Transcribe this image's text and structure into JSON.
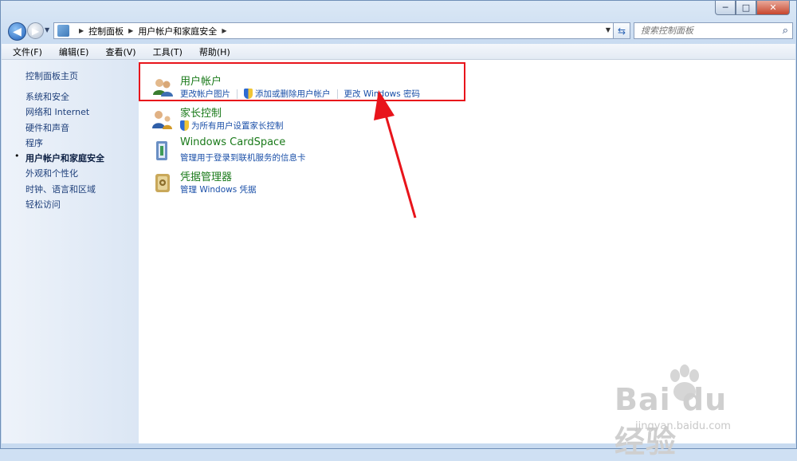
{
  "window": {
    "caption_minimize": "─",
    "caption_maximize": "□",
    "caption_close": "✕"
  },
  "address": {
    "crumbs": [
      "控制面板",
      "用户帐户和家庭安全"
    ],
    "search_placeholder": "搜索控制面板"
  },
  "menu": [
    "文件(F)",
    "编辑(E)",
    "查看(V)",
    "工具(T)",
    "帮助(H)"
  ],
  "sidebar": {
    "home": "控制面板主页",
    "items": [
      {
        "label": "系统和安全",
        "active": false
      },
      {
        "label": "网络和 Internet",
        "active": false
      },
      {
        "label": "硬件和声音",
        "active": false
      },
      {
        "label": "程序",
        "active": false
      },
      {
        "label": "用户帐户和家庭安全",
        "active": true
      },
      {
        "label": "外观和个性化",
        "active": false
      },
      {
        "label": "时钟、语言和区域",
        "active": false
      },
      {
        "label": "轻松访问",
        "active": false
      }
    ]
  },
  "categories": [
    {
      "title": "用户帐户",
      "icon": "user-accounts-icon",
      "links": [
        {
          "label": "更改帐户图片",
          "shield": false
        },
        {
          "label": "添加或删除用户帐户",
          "shield": true
        },
        {
          "label": "更改 Windows 密码",
          "shield": false
        }
      ]
    },
    {
      "title": "家长控制",
      "icon": "parental-controls-icon",
      "links": [
        {
          "label": "为所有用户设置家长控制",
          "shield": true
        }
      ]
    },
    {
      "title": "Windows CardSpace",
      "icon": "cardspace-icon",
      "links": [
        {
          "label": "管理用于登录到联机服务的信息卡",
          "shield": false
        }
      ]
    },
    {
      "title": "凭据管理器",
      "icon": "credential-manager-icon",
      "links": [
        {
          "label": "管理 Windows 凭据",
          "shield": false
        }
      ]
    }
  ],
  "watermark": {
    "logo": "Bai  du 经验",
    "url": "jingyan.baidu.com"
  },
  "colors": {
    "highlight": "#e8141b",
    "category_title": "#1a7a1a",
    "link": "#1a4fa8"
  }
}
